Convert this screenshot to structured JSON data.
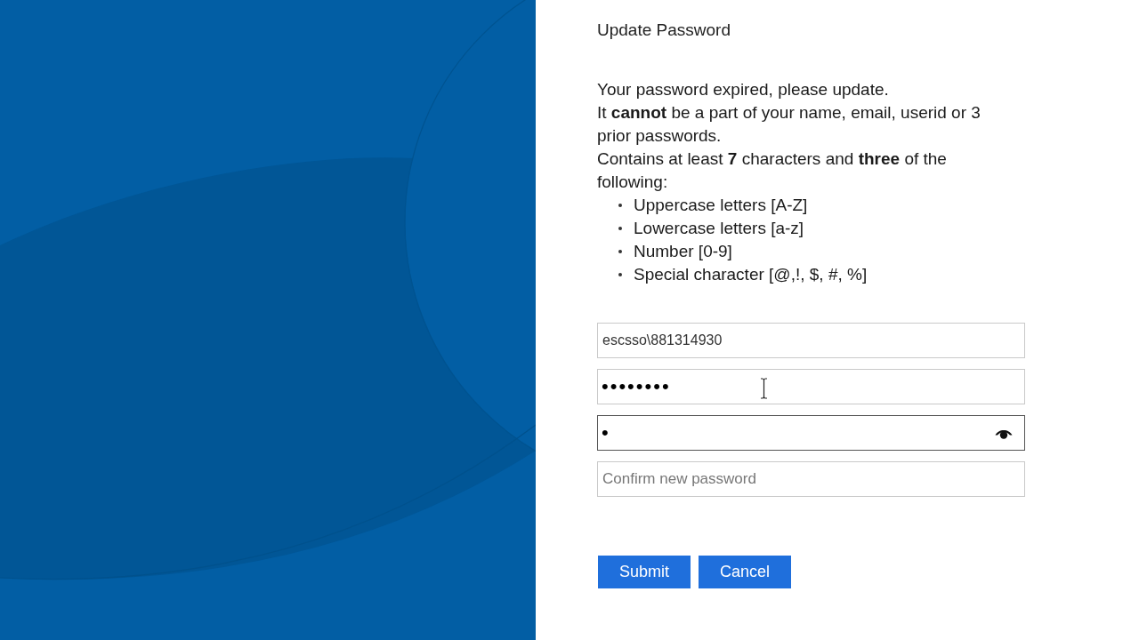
{
  "title": "Update Password",
  "instructions": [
    "Your password expired, please update.",
    "It **cannot** be a part of your name, email, userid or 3 prior passwords.",
    "Contains at least **7** characters and **three** of the following:"
  ],
  "requirements": [
    "Uppercase letters [A-Z]",
    "Lowercase letters [a-z]",
    "Number [0-9]",
    "Special character [@,!, $, #, %]"
  ],
  "fields": [
    {
      "kind": "username",
      "value": "escsso\\881314930",
      "focused": false,
      "reveal_icon": false
    },
    {
      "kind": "password",
      "value": "••••••••",
      "focused": false,
      "reveal_icon": false
    },
    {
      "kind": "password",
      "value": "•",
      "focused": true,
      "reveal_icon": true
    },
    {
      "kind": "password",
      "placeholder": "Confirm new password",
      "focused": false,
      "reveal_icon": false
    }
  ],
  "buttons": [
    "Submit",
    "Cancel"
  ]
}
